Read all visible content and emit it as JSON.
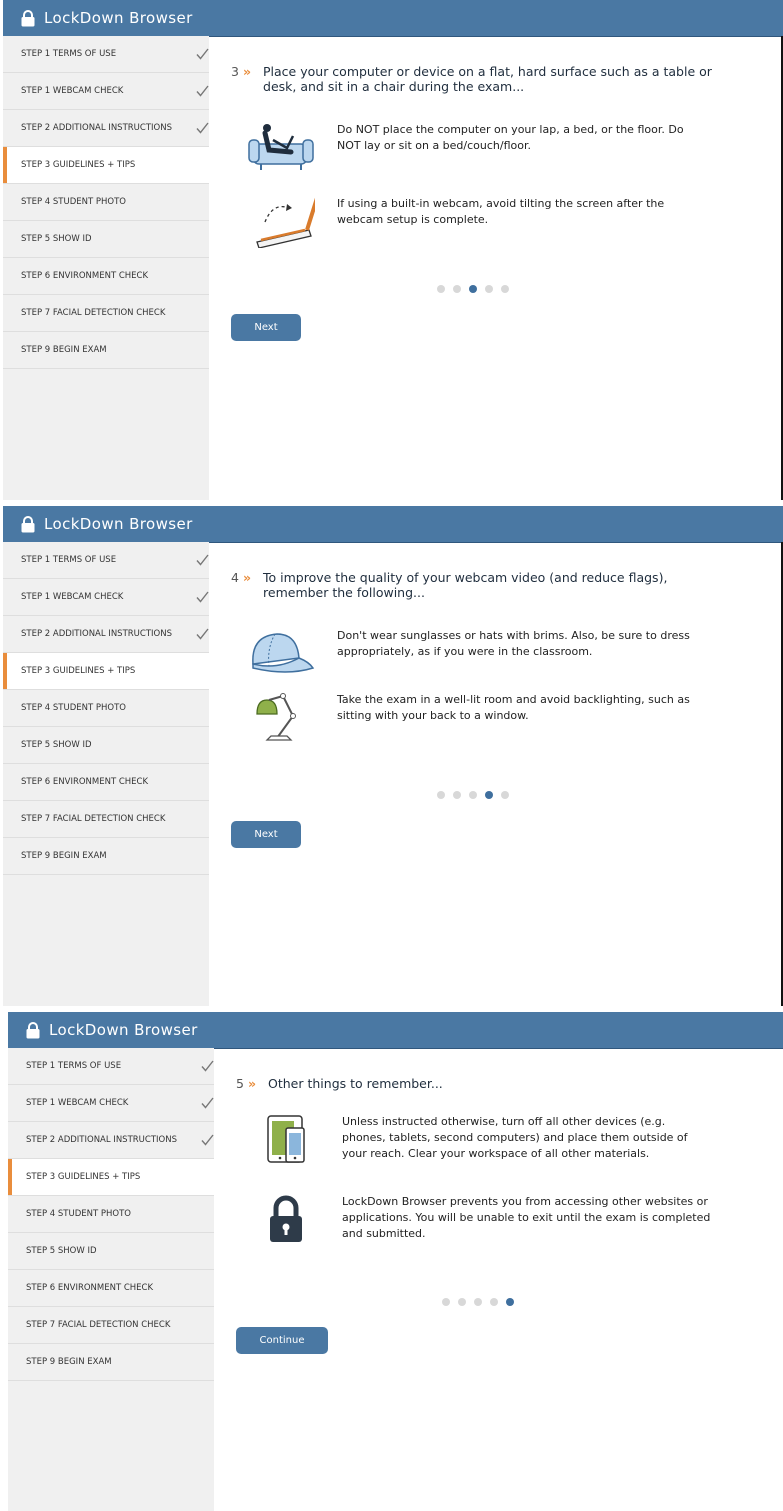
{
  "app": {
    "title": "LockDown Browser"
  },
  "sidebar": {
    "steps": [
      {
        "label": "STEP 1 TERMS OF USE",
        "done": true
      },
      {
        "label": "STEP 1 WEBCAM CHECK",
        "done": true
      },
      {
        "label": "STEP 2 ADDITIONAL INSTRUCTIONS",
        "done": true
      },
      {
        "label": "STEP 3 GUIDELINES + TIPS",
        "active": true
      },
      {
        "label": "STEP 4 STUDENT PHOTO"
      },
      {
        "label": "STEP 5 SHOW ID"
      },
      {
        "label": "STEP 6 ENVIRONMENT CHECK"
      },
      {
        "label": "STEP 7 FACIAL DETECTION CHECK"
      },
      {
        "label": "STEP 9 BEGIN EXAM"
      }
    ]
  },
  "colors": {
    "header": "#4a78a3",
    "accent": "#e98d3c",
    "dot_active": "#3f6f9e"
  },
  "panels": [
    {
      "number": "3",
      "heading": "Place your computer or device on a flat, hard surface such as a table or desk, and sit in a chair during the exam...",
      "tips": [
        {
          "icon": "person-on-couch-icon",
          "text": "Do NOT place the computer on your lap, a bed, or the floor. Do NOT lay or sit on a bed/couch/floor."
        },
        {
          "icon": "tilted-laptop-icon",
          "text": "If using a built-in webcam, avoid tilting the screen after the webcam setup is complete."
        }
      ],
      "active_dot": 3,
      "button": "Next"
    },
    {
      "number": "4",
      "heading": "To improve the quality of your webcam video (and reduce flags), remember the following...",
      "tips": [
        {
          "icon": "cap-icon",
          "text": "Don't wear sunglasses or hats with brims. Also, be sure to dress appropriately, as if you were in the classroom."
        },
        {
          "icon": "desk-lamp-icon",
          "text": "Take the exam in a well-lit room and avoid backlighting, such as sitting with your back to a window."
        }
      ],
      "active_dot": 4,
      "button": "Next"
    },
    {
      "number": "5",
      "heading": "Other things to remember...",
      "tips": [
        {
          "icon": "devices-icon",
          "text": "Unless instructed otherwise, turn off all other devices (e.g. phones, tablets, second computers) and place them outside of your reach. Clear your workspace of all other materials."
        },
        {
          "icon": "padlock-icon",
          "text": "LockDown Browser prevents you from accessing other websites or applications. You will be unable to exit until the exam is completed and submitted."
        }
      ],
      "active_dot": 5,
      "button": "Continue"
    }
  ],
  "dots_total": 5
}
